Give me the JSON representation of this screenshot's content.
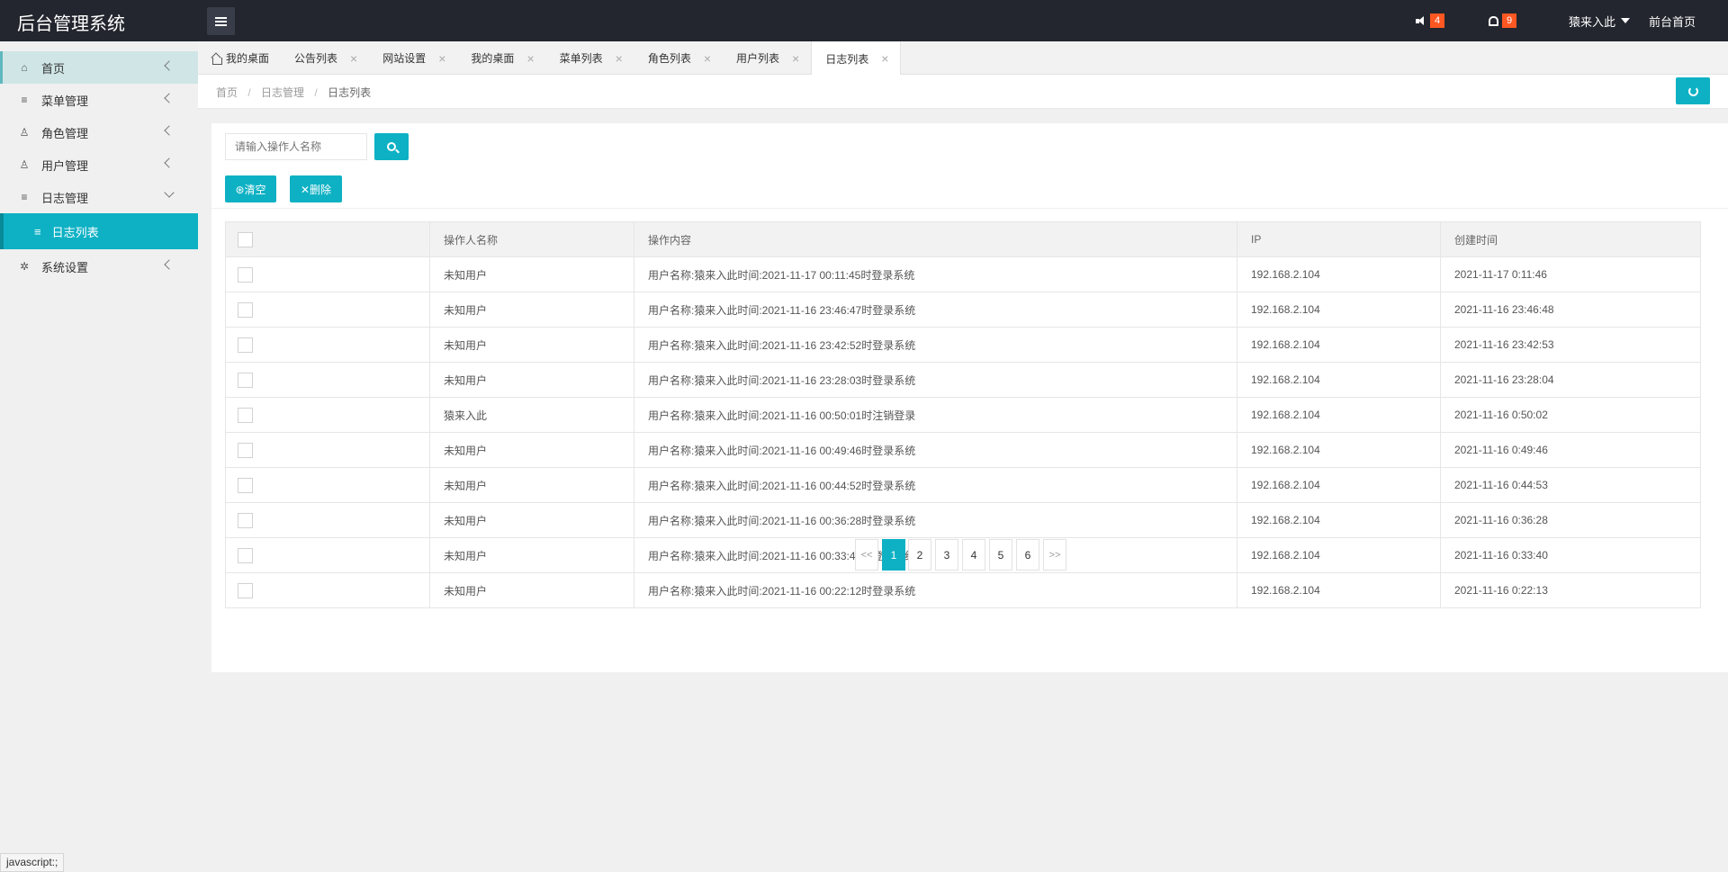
{
  "app": {
    "brand": "后台管理系统"
  },
  "topbar": {
    "notice_count": "4",
    "bell_count": "9",
    "user_name": "猿来入此",
    "frontend_link": "前台首页"
  },
  "sidebar": {
    "items": [
      {
        "label": "首页"
      },
      {
        "label": "菜单管理"
      },
      {
        "label": "角色管理"
      },
      {
        "label": "用户管理"
      },
      {
        "label": "日志管理"
      },
      {
        "label": "日志列表"
      },
      {
        "label": "系统设置"
      }
    ]
  },
  "status_url": "javascript:;",
  "tabs": [
    {
      "label": "我的桌面"
    },
    {
      "label": "公告列表"
    },
    {
      "label": "网站设置"
    },
    {
      "label": "我的桌面"
    },
    {
      "label": "菜单列表"
    },
    {
      "label": "角色列表"
    },
    {
      "label": "用户列表"
    },
    {
      "label": "日志列表"
    }
  ],
  "breadcrumb": {
    "home": "首页",
    "parent": "日志管理",
    "current": "日志列表",
    "separator": "/"
  },
  "search": {
    "placeholder": "请输入操作人名称"
  },
  "actions": {
    "clear_label": "⊛清空",
    "delete_label": "✕删除"
  },
  "table": {
    "columns": [
      "操作人名称",
      "操作内容",
      "IP",
      "创建时间"
    ],
    "rows": [
      [
        "未知用户",
        "用户名称:猿来入此时间:2021-11-17 00:11:45时登录系统",
        "192.168.2.104",
        "2021-11-17 0:11:46"
      ],
      [
        "未知用户",
        "用户名称:猿来入此时间:2021-11-16 23:46:47时登录系统",
        "192.168.2.104",
        "2021-11-16 23:46:48"
      ],
      [
        "未知用户",
        "用户名称:猿来入此时间:2021-11-16 23:42:52时登录系统",
        "192.168.2.104",
        "2021-11-16 23:42:53"
      ],
      [
        "未知用户",
        "用户名称:猿来入此时间:2021-11-16 23:28:03时登录系统",
        "192.168.2.104",
        "2021-11-16 23:28:04"
      ],
      [
        "猿来入此",
        "用户名称:猿来入此时间:2021-11-16 00:50:01时注销登录",
        "192.168.2.104",
        "2021-11-16 0:50:02"
      ],
      [
        "未知用户",
        "用户名称:猿来入此时间:2021-11-16 00:49:46时登录系统",
        "192.168.2.104",
        "2021-11-16 0:49:46"
      ],
      [
        "未知用户",
        "用户名称:猿来入此时间:2021-11-16 00:44:52时登录系统",
        "192.168.2.104",
        "2021-11-16 0:44:53"
      ],
      [
        "未知用户",
        "用户名称:猿来入此时间:2021-11-16 00:36:28时登录系统",
        "192.168.2.104",
        "2021-11-16 0:36:28"
      ],
      [
        "未知用户",
        "用户名称:猿来入此时间:2021-11-16 00:33:40时登录系统",
        "192.168.2.104",
        "2021-11-16 0:33:40"
      ],
      [
        "未知用户",
        "用户名称:猿来入此时间:2021-11-16 00:22:12时登录系统",
        "192.168.2.104",
        "2021-11-16 0:22:13"
      ]
    ]
  },
  "pagination": {
    "prev": "<<",
    "pages": [
      "1",
      "2",
      "3",
      "4",
      "5",
      "6"
    ],
    "next": ">>",
    "current": "1"
  },
  "colors": {
    "accent": "#0eb1c4",
    "topbar": "#23262e",
    "badge": "#ff5722"
  }
}
